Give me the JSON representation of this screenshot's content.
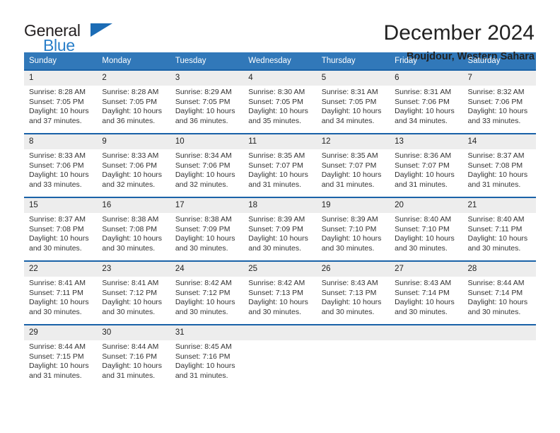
{
  "brand": {
    "name_part1": "General",
    "name_part2": "Blue",
    "flag_icon": "blue-triangle-flag-icon"
  },
  "header": {
    "title": "December 2024",
    "subtitle": "Boujdour, Western Sahara"
  },
  "colors": {
    "header_blue": "#3178b9",
    "separator_blue": "#1a62a8",
    "daynum_band_gray": "#ededed",
    "brand_blue": "#2a7fc9",
    "text": "#222222"
  },
  "weekdays": [
    "Sunday",
    "Monday",
    "Tuesday",
    "Wednesday",
    "Thursday",
    "Friday",
    "Saturday"
  ],
  "weeks": [
    {
      "days": [
        {
          "num": "1",
          "sunrise": "Sunrise: 8:28 AM",
          "sunset": "Sunset: 7:05 PM",
          "daylight1": "Daylight: 10 hours",
          "daylight2": "and 37 minutes."
        },
        {
          "num": "2",
          "sunrise": "Sunrise: 8:28 AM",
          "sunset": "Sunset: 7:05 PM",
          "daylight1": "Daylight: 10 hours",
          "daylight2": "and 36 minutes."
        },
        {
          "num": "3",
          "sunrise": "Sunrise: 8:29 AM",
          "sunset": "Sunset: 7:05 PM",
          "daylight1": "Daylight: 10 hours",
          "daylight2": "and 36 minutes."
        },
        {
          "num": "4",
          "sunrise": "Sunrise: 8:30 AM",
          "sunset": "Sunset: 7:05 PM",
          "daylight1": "Daylight: 10 hours",
          "daylight2": "and 35 minutes."
        },
        {
          "num": "5",
          "sunrise": "Sunrise: 8:31 AM",
          "sunset": "Sunset: 7:05 PM",
          "daylight1": "Daylight: 10 hours",
          "daylight2": "and 34 minutes."
        },
        {
          "num": "6",
          "sunrise": "Sunrise: 8:31 AM",
          "sunset": "Sunset: 7:06 PM",
          "daylight1": "Daylight: 10 hours",
          "daylight2": "and 34 minutes."
        },
        {
          "num": "7",
          "sunrise": "Sunrise: 8:32 AM",
          "sunset": "Sunset: 7:06 PM",
          "daylight1": "Daylight: 10 hours",
          "daylight2": "and 33 minutes."
        }
      ]
    },
    {
      "days": [
        {
          "num": "8",
          "sunrise": "Sunrise: 8:33 AM",
          "sunset": "Sunset: 7:06 PM",
          "daylight1": "Daylight: 10 hours",
          "daylight2": "and 33 minutes."
        },
        {
          "num": "9",
          "sunrise": "Sunrise: 8:33 AM",
          "sunset": "Sunset: 7:06 PM",
          "daylight1": "Daylight: 10 hours",
          "daylight2": "and 32 minutes."
        },
        {
          "num": "10",
          "sunrise": "Sunrise: 8:34 AM",
          "sunset": "Sunset: 7:06 PM",
          "daylight1": "Daylight: 10 hours",
          "daylight2": "and 32 minutes."
        },
        {
          "num": "11",
          "sunrise": "Sunrise: 8:35 AM",
          "sunset": "Sunset: 7:07 PM",
          "daylight1": "Daylight: 10 hours",
          "daylight2": "and 31 minutes."
        },
        {
          "num": "12",
          "sunrise": "Sunrise: 8:35 AM",
          "sunset": "Sunset: 7:07 PM",
          "daylight1": "Daylight: 10 hours",
          "daylight2": "and 31 minutes."
        },
        {
          "num": "13",
          "sunrise": "Sunrise: 8:36 AM",
          "sunset": "Sunset: 7:07 PM",
          "daylight1": "Daylight: 10 hours",
          "daylight2": "and 31 minutes."
        },
        {
          "num": "14",
          "sunrise": "Sunrise: 8:37 AM",
          "sunset": "Sunset: 7:08 PM",
          "daylight1": "Daylight: 10 hours",
          "daylight2": "and 31 minutes."
        }
      ]
    },
    {
      "days": [
        {
          "num": "15",
          "sunrise": "Sunrise: 8:37 AM",
          "sunset": "Sunset: 7:08 PM",
          "daylight1": "Daylight: 10 hours",
          "daylight2": "and 30 minutes."
        },
        {
          "num": "16",
          "sunrise": "Sunrise: 8:38 AM",
          "sunset": "Sunset: 7:08 PM",
          "daylight1": "Daylight: 10 hours",
          "daylight2": "and 30 minutes."
        },
        {
          "num": "17",
          "sunrise": "Sunrise: 8:38 AM",
          "sunset": "Sunset: 7:09 PM",
          "daylight1": "Daylight: 10 hours",
          "daylight2": "and 30 minutes."
        },
        {
          "num": "18",
          "sunrise": "Sunrise: 8:39 AM",
          "sunset": "Sunset: 7:09 PM",
          "daylight1": "Daylight: 10 hours",
          "daylight2": "and 30 minutes."
        },
        {
          "num": "19",
          "sunrise": "Sunrise: 8:39 AM",
          "sunset": "Sunset: 7:10 PM",
          "daylight1": "Daylight: 10 hours",
          "daylight2": "and 30 minutes."
        },
        {
          "num": "20",
          "sunrise": "Sunrise: 8:40 AM",
          "sunset": "Sunset: 7:10 PM",
          "daylight1": "Daylight: 10 hours",
          "daylight2": "and 30 minutes."
        },
        {
          "num": "21",
          "sunrise": "Sunrise: 8:40 AM",
          "sunset": "Sunset: 7:11 PM",
          "daylight1": "Daylight: 10 hours",
          "daylight2": "and 30 minutes."
        }
      ]
    },
    {
      "days": [
        {
          "num": "22",
          "sunrise": "Sunrise: 8:41 AM",
          "sunset": "Sunset: 7:11 PM",
          "daylight1": "Daylight: 10 hours",
          "daylight2": "and 30 minutes."
        },
        {
          "num": "23",
          "sunrise": "Sunrise: 8:41 AM",
          "sunset": "Sunset: 7:12 PM",
          "daylight1": "Daylight: 10 hours",
          "daylight2": "and 30 minutes."
        },
        {
          "num": "24",
          "sunrise": "Sunrise: 8:42 AM",
          "sunset": "Sunset: 7:12 PM",
          "daylight1": "Daylight: 10 hours",
          "daylight2": "and 30 minutes."
        },
        {
          "num": "25",
          "sunrise": "Sunrise: 8:42 AM",
          "sunset": "Sunset: 7:13 PM",
          "daylight1": "Daylight: 10 hours",
          "daylight2": "and 30 minutes."
        },
        {
          "num": "26",
          "sunrise": "Sunrise: 8:43 AM",
          "sunset": "Sunset: 7:13 PM",
          "daylight1": "Daylight: 10 hours",
          "daylight2": "and 30 minutes."
        },
        {
          "num": "27",
          "sunrise": "Sunrise: 8:43 AM",
          "sunset": "Sunset: 7:14 PM",
          "daylight1": "Daylight: 10 hours",
          "daylight2": "and 30 minutes."
        },
        {
          "num": "28",
          "sunrise": "Sunrise: 8:44 AM",
          "sunset": "Sunset: 7:14 PM",
          "daylight1": "Daylight: 10 hours",
          "daylight2": "and 30 minutes."
        }
      ]
    },
    {
      "days": [
        {
          "num": "29",
          "sunrise": "Sunrise: 8:44 AM",
          "sunset": "Sunset: 7:15 PM",
          "daylight1": "Daylight: 10 hours",
          "daylight2": "and 31 minutes."
        },
        {
          "num": "30",
          "sunrise": "Sunrise: 8:44 AM",
          "sunset": "Sunset: 7:16 PM",
          "daylight1": "Daylight: 10 hours",
          "daylight2": "and 31 minutes."
        },
        {
          "num": "31",
          "sunrise": "Sunrise: 8:45 AM",
          "sunset": "Sunset: 7:16 PM",
          "daylight1": "Daylight: 10 hours",
          "daylight2": "and 31 minutes."
        },
        {
          "num": "",
          "sunrise": "",
          "sunset": "",
          "daylight1": "",
          "daylight2": ""
        },
        {
          "num": "",
          "sunrise": "",
          "sunset": "",
          "daylight1": "",
          "daylight2": ""
        },
        {
          "num": "",
          "sunrise": "",
          "sunset": "",
          "daylight1": "",
          "daylight2": ""
        },
        {
          "num": "",
          "sunrise": "",
          "sunset": "",
          "daylight1": "",
          "daylight2": ""
        }
      ]
    }
  ]
}
